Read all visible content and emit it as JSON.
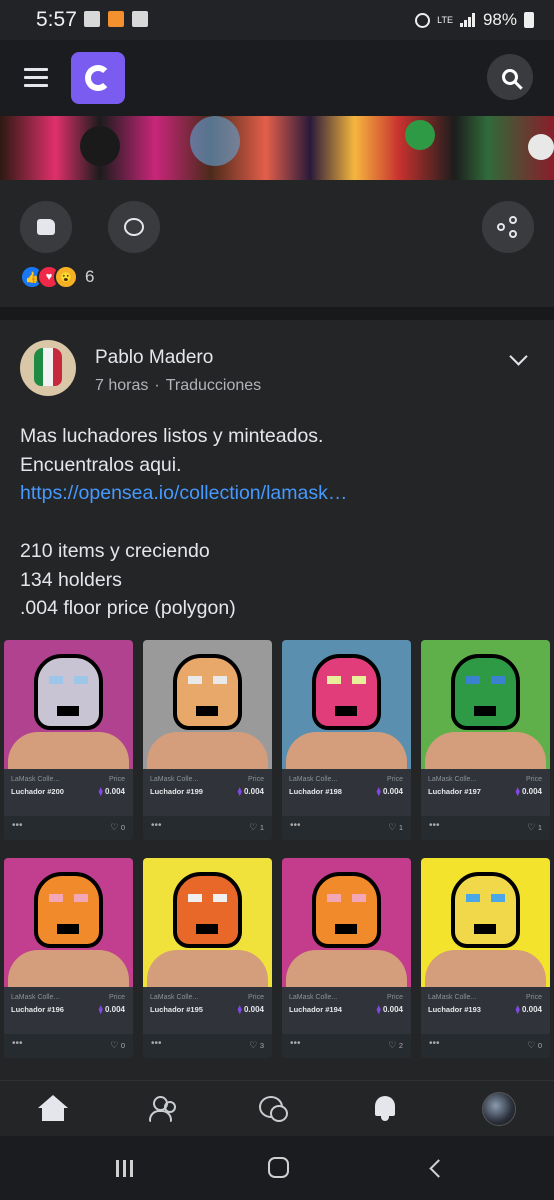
{
  "status_bar": {
    "time": "5:57",
    "network": "LTE",
    "battery": "98%"
  },
  "post_above": {
    "reaction_count": "6"
  },
  "post": {
    "author": "Pablo Madero",
    "time": "7 horas",
    "separator": "·",
    "translate_label": "Traducciones",
    "lines": [
      "Mas luchadores listos y minteados.",
      "Encuentralos aqui."
    ],
    "link": "https://opensea.io/collection/lamask…",
    "stats": [
      "210 items y creciendo",
      "134 holders",
      ".004 floor price (polygon)"
    ]
  },
  "nft_cards": [
    {
      "collection": "LaMask Colle...",
      "price_label": "Price",
      "name": "Luchador #200",
      "price": "0.004",
      "likes": "0",
      "bg": "#b0428f",
      "mask": "#c9c4d4",
      "eyes": "#9ec6e8"
    },
    {
      "collection": "LaMask Colle...",
      "price_label": "Price",
      "name": "Luchador #199",
      "price": "0.004",
      "likes": "1",
      "bg": "#9a9a9a",
      "mask": "#e8a86a",
      "eyes": "#e9e9e9"
    },
    {
      "collection": "LaMask Colle...",
      "price_label": "Price",
      "name": "Luchador #198",
      "price": "0.004",
      "likes": "1",
      "bg": "#5a8fb0",
      "mask": "#e03d7a",
      "eyes": "#e7ef9a"
    },
    {
      "collection": "LaMask Colle...",
      "price_label": "Price",
      "name": "Luchador #197",
      "price": "0.004",
      "likes": "1",
      "bg": "#5fb04a",
      "mask": "#2f9a45",
      "eyes": "#3a82d0"
    },
    {
      "collection": "LaMask Colle...",
      "price_label": "Price",
      "name": "Luchador #196",
      "price": "0.004",
      "likes": "0",
      "bg": "#c23e8e",
      "mask": "#f08a2a",
      "eyes": "#f3a7b6"
    },
    {
      "collection": "LaMask Colle...",
      "price_label": "Price",
      "name": "Luchador #195",
      "price": "0.004",
      "likes": "3",
      "bg": "#f0e23a",
      "mask": "#e8682a",
      "eyes": "#f0f0f0"
    },
    {
      "collection": "LaMask Colle...",
      "price_label": "Price",
      "name": "Luchador #194",
      "price": "0.004",
      "likes": "2",
      "bg": "#c43c8c",
      "mask": "#f08a2a",
      "eyes": "#f3a7b6"
    },
    {
      "collection": "LaMask Colle...",
      "price_label": "Price",
      "name": "Luchador #193",
      "price": "0.004",
      "likes": "0",
      "bg": "#f4e32c",
      "mask": "#f1d84a",
      "eyes": "#4aa8e8"
    }
  ]
}
